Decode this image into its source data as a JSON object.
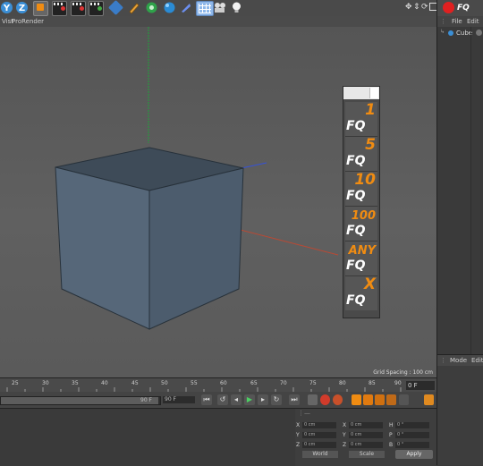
{
  "toolbar": {
    "axis_y": "Y",
    "axis_z": "Z",
    "plugin_title": "FQ"
  },
  "viewport": {
    "menu": [
      "Vist",
      "ProRender"
    ],
    "grid_spacing": "Grid Spacing : 100 cm"
  },
  "fq_panel": {
    "buttons": [
      {
        "num": "1",
        "text": "FQ"
      },
      {
        "num": "5",
        "text": "FQ"
      },
      {
        "num": "10",
        "text": "FQ"
      },
      {
        "num": "100",
        "text": "FQ"
      },
      {
        "num": "ANY",
        "text": "FQ"
      },
      {
        "num": "X",
        "text": "FQ"
      }
    ]
  },
  "object_manager": {
    "menu": [
      "File",
      "Edit"
    ],
    "object": "Cube"
  },
  "attributes": {
    "menu": [
      "Mode",
      "Edit"
    ]
  },
  "timeline": {
    "ticks": [
      "25",
      "30",
      "35",
      "40",
      "45",
      "50",
      "55",
      "60",
      "65",
      "70",
      "75",
      "80",
      "85",
      "90"
    ],
    "current_frame": "0 F",
    "end_field": "90 F",
    "end_frame": "90 F"
  },
  "coordinates": {
    "rows": [
      {
        "a": "X",
        "av": "0 cm",
        "b": "X",
        "bv": "0 cm",
        "c": "H",
        "cv": "0 °"
      },
      {
        "a": "Y",
        "av": "0 cm",
        "b": "Y",
        "bv": "0 cm",
        "c": "P",
        "cv": "0 °"
      },
      {
        "a": "Z",
        "av": "0 cm",
        "b": "Z",
        "bv": "0 cm",
        "c": "B",
        "cv": "0 °"
      }
    ],
    "world": "World",
    "scale": "Scale",
    "apply": "Apply"
  },
  "colors": {
    "accent_orange": "#f08c12",
    "fq_red": "#e02020",
    "axis_blue": "#3b8fd6"
  }
}
